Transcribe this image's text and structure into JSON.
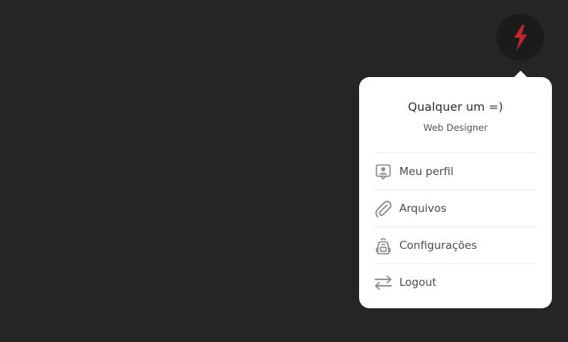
{
  "user_menu_button": {
    "icon": "lightning-bolt-icon",
    "icon_color": "#c0282d",
    "background": "#1b1b1b"
  },
  "dropdown": {
    "user": {
      "name": "Qualquer um =)",
      "role": "Web Designer"
    },
    "items": [
      {
        "label": "Meu perfil",
        "icon": "profile-badge-icon"
      },
      {
        "label": "Arquivos",
        "icon": "paperclip-icon"
      },
      {
        "label": "Configurações",
        "icon": "backpack-icon"
      },
      {
        "label": "Logout",
        "icon": "swap-arrows-icon"
      }
    ]
  },
  "colors": {
    "page_background": "#252525",
    "dropdown_background": "#ffffff",
    "icon_gray": "#8a8a8a"
  }
}
